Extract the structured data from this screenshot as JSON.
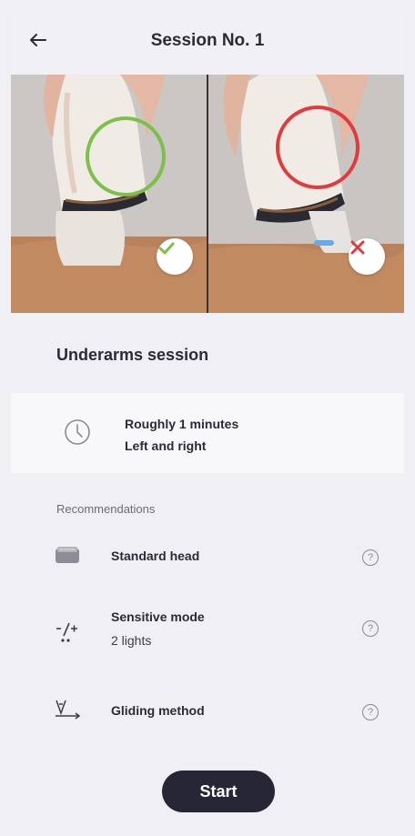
{
  "header": {
    "title": "Session No. 1",
    "back_icon": "arrow-left-icon"
  },
  "hero": {
    "left_status": "correct",
    "right_status": "incorrect",
    "colors": {
      "correct": "#7cc04a",
      "incorrect": "#e23b3b"
    }
  },
  "session": {
    "title": "Underarms session"
  },
  "duration": {
    "icon": "clock-icon",
    "line1": "Roughly 1 minutes",
    "line2": "Left and right"
  },
  "recommendations": {
    "heading": "Recommendations",
    "items": [
      {
        "icon": "head-attachment-icon",
        "name": "Standard head",
        "sub": ""
      },
      {
        "icon": "sensitive-mode-icon",
        "name": "Sensitive mode",
        "sub": "2 lights"
      },
      {
        "icon": "gliding-method-icon",
        "name": "Gliding method",
        "sub": ""
      }
    ],
    "help_glyph": "?"
  },
  "actions": {
    "start_label": "Start"
  }
}
